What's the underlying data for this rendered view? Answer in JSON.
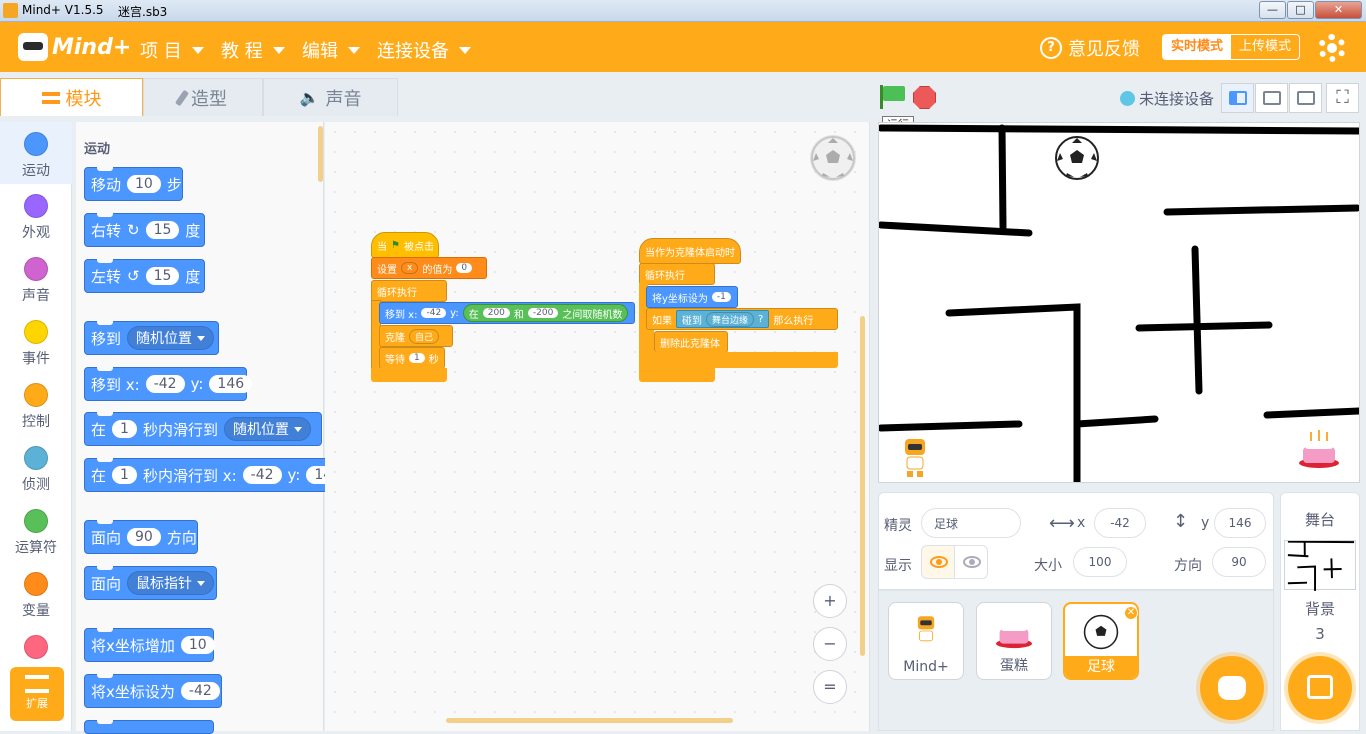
{
  "window": {
    "app_title": "Mind+ V1.5.5",
    "file_name": "迷宫.sb3",
    "minimize": "—",
    "maximize": "□",
    "close": "✕"
  },
  "menubar": {
    "logo": "Mind+",
    "items": [
      "项 目",
      "教 程",
      "编辑",
      "连接设备"
    ],
    "feedback": "意见反馈",
    "mode_live": "实时模式",
    "mode_upload": "上传模式"
  },
  "tabs": {
    "code": "模块",
    "costumes": "造型",
    "sounds": "声音"
  },
  "categories": [
    {
      "label": "运动",
      "color": "#4c97ff"
    },
    {
      "label": "外观",
      "color": "#9966ff"
    },
    {
      "label": "声音",
      "color": "#cf63cf"
    },
    {
      "label": "事件",
      "color": "#ffd500"
    },
    {
      "label": "控制",
      "color": "#ffab19"
    },
    {
      "label": "侦测",
      "color": "#5cb1d6"
    },
    {
      "label": "运算符",
      "color": "#59c059"
    },
    {
      "label": "变量",
      "color": "#ff8c1a"
    },
    {
      "label": "",
      "color": "#ff6680"
    }
  ],
  "extensions_label": "扩展",
  "palette": {
    "title": "运动",
    "move": {
      "pre": "移动",
      "steps": "10",
      "post": "步"
    },
    "turn_right": {
      "pre": "右转",
      "icon": "↻",
      "deg": "15",
      "post": "度"
    },
    "turn_left": {
      "pre": "左转",
      "icon": "↺",
      "deg": "15",
      "post": "度"
    },
    "goto": {
      "pre": "移到",
      "target": "随机位置"
    },
    "goto_xy": {
      "pre": "移到 x:",
      "x": "-42",
      "ylab": "y:",
      "y": "146"
    },
    "glide": {
      "pre": "在",
      "secs": "1",
      "mid": "秒内滑行到",
      "target": "随机位置"
    },
    "glide_xy": {
      "pre": "在",
      "secs": "1",
      "mid": "秒内滑行到 x:",
      "x": "-42",
      "ylab": "y:",
      "y": "14"
    },
    "point_dir": {
      "pre": "面向",
      "deg": "90",
      "post": "方向"
    },
    "point_towards": {
      "pre": "面向",
      "target": "鼠标指针"
    },
    "change_x": {
      "pre": "将x坐标增加",
      "val": "10"
    },
    "set_x": {
      "pre": "将x坐标设为",
      "val": "-42"
    }
  },
  "script1": {
    "hat_pre": "当",
    "hat_post": "被点击",
    "set_pre": "设置",
    "set_var": "x",
    "set_mid": "的值为",
    "set_val": "0",
    "forever": "循环执行",
    "goto_pre": "移到 x:",
    "goto_x": "-42",
    "goto_y_lab": "y:",
    "rand_pre": "在",
    "rand_a": "200",
    "rand_mid": "和",
    "rand_b": "-200",
    "rand_post": "之间取随机数",
    "clone_pre": "克隆",
    "clone_target": "自己",
    "wait_pre": "等待",
    "wait_val": "1",
    "wait_post": "秒"
  },
  "script2": {
    "hat": "当作为克隆体启动时",
    "forever": "循环执行",
    "sety_pre": "将y坐标设为",
    "sety_val": "-1",
    "if_pre": "如果",
    "touching_pre": "碰到",
    "touching_target": "舞台边缘",
    "touching_q": "?",
    "if_post": "那么执行",
    "delete": "删除此克隆体"
  },
  "zoom": {
    "in": "+",
    "out": "−",
    "reset": "="
  },
  "stage_header": {
    "run_tooltip": "运行",
    "device_status": "未连接设备",
    "fullscreen": "⛶"
  },
  "sprite_info": {
    "sprite_label": "精灵",
    "sprite_name": "足球",
    "x_label": "x",
    "x": "-42",
    "y_label": "y",
    "y": "146",
    "show_label": "显示",
    "size_label": "大小",
    "size": "100",
    "direction_label": "方向",
    "direction": "90"
  },
  "sprites": [
    {
      "name": "Mind+"
    },
    {
      "name": "蛋糕"
    },
    {
      "name": "足球"
    }
  ],
  "stage_selector": {
    "title": "舞台",
    "backdrop_label": "背景",
    "backdrop_count": "3"
  }
}
